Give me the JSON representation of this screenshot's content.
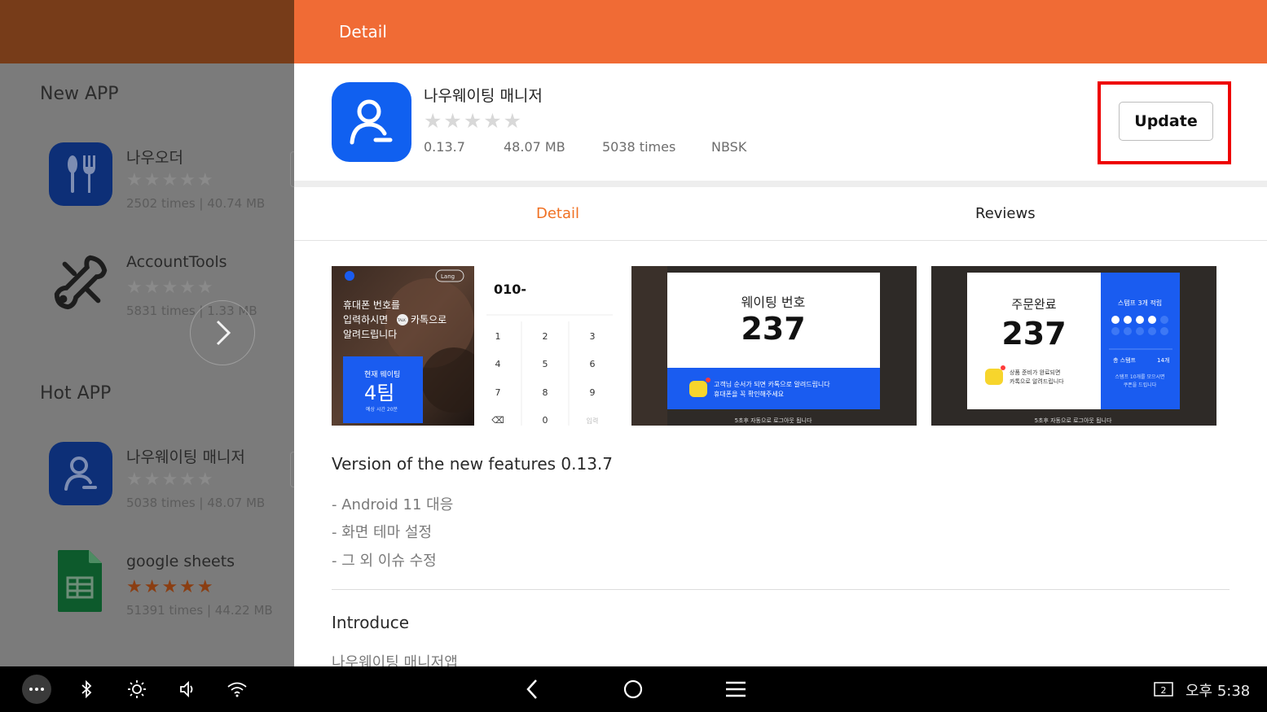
{
  "left_panel": {
    "new_app_title": "New APP",
    "hot_app_title": "Hot APP",
    "new_apps": [
      {
        "name": "나우오더",
        "stars": "★★★★★",
        "meta": "2502 times | 40.74 MB",
        "icon": "fork-knife-icon"
      },
      {
        "name": "AccountTools",
        "stars": "★★★★★",
        "meta": "5831 times | 1.33 MB",
        "icon": "wrench-tools-icon"
      }
    ],
    "hot_apps": [
      {
        "name": "나우웨이팅 매니저",
        "stars": "★★★★★",
        "meta": "5038 times | 48.07 MB",
        "icon": "person-icon"
      },
      {
        "name": "google sheets",
        "stars": "★★★★★",
        "meta": "51391 times | 44.22 MB",
        "icon": "sheets-icon"
      }
    ],
    "next_icon": "chevron-right-icon"
  },
  "header": {
    "title": "Detail"
  },
  "app": {
    "name": "나우웨이팅 매니저",
    "stars": "★★★★★",
    "version": "0.13.7",
    "size": "48.07 MB",
    "downloads": "5038 times",
    "developer": "NBSK",
    "icon": "person-icon"
  },
  "update_label": "Update",
  "tabs": {
    "detail": "Detail",
    "reviews": "Reviews"
  },
  "screenshots": {
    "s1": {
      "headline_1": "휴대폰 번호를",
      "headline_2": "입력하시면",
      "headline_3": "카톡으로",
      "headline_4": "알려드립니다",
      "talk": "TALK",
      "lang": "Lang",
      "wait_label": "현재 웨이팅",
      "wait_value": "4팀",
      "wait_sub": "예상 시간 20분",
      "phone": "010-",
      "keys": [
        "1",
        "2",
        "3",
        "4",
        "5",
        "6",
        "7",
        "8",
        "9",
        "⌫",
        "0",
        "입력"
      ]
    },
    "s2": {
      "title": "웨이팅 번호",
      "number": "237",
      "msg_1": "고객님 순서가 되면 카톡으로 알려드립니다",
      "msg_2": "휴대폰을 꼭 확인해주세요",
      "footer": "5초후 자동으로 로그아웃 됩니다"
    },
    "s3": {
      "title": "주문완료",
      "number": "237",
      "msg_1": "상품 준비가 완료되면",
      "msg_2": "카톡으로 알려드립니다",
      "stamp_title": "스탬프 3개 적립",
      "stamp_total_label": "총 스탬프",
      "stamp_total": "14개",
      "stamp_note_1": "스탬프 10개를 모으시면",
      "stamp_note_2": "쿠폰을 드립니다",
      "footer": "5초후 자동으로 로그아웃 됩니다"
    }
  },
  "version_title": "Version of the new features 0.13.7",
  "notes": [
    "- Android 11 대응",
    "- 화면 테마 설정",
    "- 그 외 이슈 수정"
  ],
  "introduce_title": "Introduce",
  "introduce_text": "나우웨이팅 매니저앱",
  "navbar": {
    "icons": [
      "more-icon",
      "bluetooth-icon",
      "brightness-icon",
      "volume-icon",
      "wifi-icon",
      "back-icon",
      "home-icon",
      "menu-icon",
      "screen-badge-icon"
    ],
    "screen_badge": "2",
    "clock": "오후 5:38"
  }
}
